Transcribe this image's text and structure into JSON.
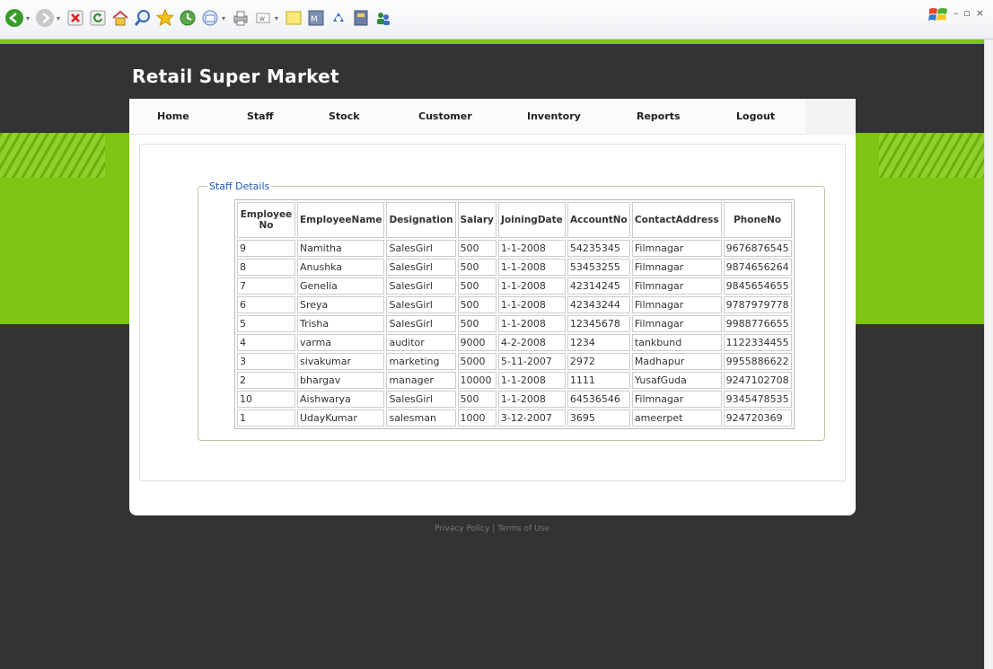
{
  "browser": {
    "icons": [
      "back-icon",
      "forward-icon",
      "stop-icon",
      "refresh-icon",
      "home-icon",
      "search-icon",
      "favorites-icon",
      "history-icon",
      "mail-icon",
      "print-icon",
      "edit-icon",
      "notes-icon",
      "messenger-icon",
      "research-icon",
      "translate-icon",
      "people-icon"
    ],
    "window_controls": [
      "–",
      "▫",
      "×"
    ]
  },
  "site": {
    "title": "Retail Super Market"
  },
  "nav": {
    "items": [
      "Home",
      "Staff",
      "Stock",
      "Customer",
      "Inventory",
      "Reports",
      "Logout"
    ]
  },
  "staff_details": {
    "legend": "Staff Details",
    "columns": [
      "Employee No",
      "EmployeeName",
      "Designation",
      "Salary",
      "JoiningDate",
      "AccountNo",
      "ContactAddress",
      "PhoneNo"
    ],
    "rows": [
      [
        "9",
        "Namitha",
        "SalesGirl",
        "500",
        "1-1-2008",
        "54235345",
        "Filmnagar",
        "9676876545"
      ],
      [
        "8",
        "Anushka",
        "SalesGirl",
        "500",
        "1-1-2008",
        "53453255",
        "Filmnagar",
        "9874656264"
      ],
      [
        "7",
        "Genelia",
        "SalesGirl",
        "500",
        "1-1-2008",
        "42314245",
        "Filmnagar",
        "9845654655"
      ],
      [
        "6",
        "Sreya",
        "SalesGirl",
        "500",
        "1-1-2008",
        "42343244",
        "Filmnagar",
        "9787979778"
      ],
      [
        "5",
        "Trisha",
        "SalesGirl",
        "500",
        "1-1-2008",
        "12345678",
        "Filmnagar",
        "9988776655"
      ],
      [
        "4",
        "varma",
        "auditor",
        "9000",
        "4-2-2008",
        "1234",
        "tankbund",
        "1122334455"
      ],
      [
        "3",
        "sivakumar",
        "marketing",
        "5000",
        "5-11-2007",
        "2972",
        "Madhapur",
        "9955886622"
      ],
      [
        "2",
        "bhargav",
        "manager",
        "10000",
        "1-1-2008",
        "1111",
        "YusafGuda",
        "9247102708"
      ],
      [
        "10",
        "Aishwarya",
        "SalesGirl",
        "500",
        "1-1-2008",
        "64536546",
        "Filmnagar",
        "9345478535"
      ],
      [
        "1",
        "UdayKumar",
        "salesman",
        "1000",
        "3-12-2007",
        "3695",
        "ameerpet",
        "924720369"
      ]
    ]
  },
  "footer": {
    "privacy": "Privacy Policy",
    "separator": " | ",
    "terms": "Terms of Use"
  },
  "colors": {
    "accent_green": "#7cc514",
    "background": "#333333",
    "legend_blue": "#1a56b0"
  }
}
